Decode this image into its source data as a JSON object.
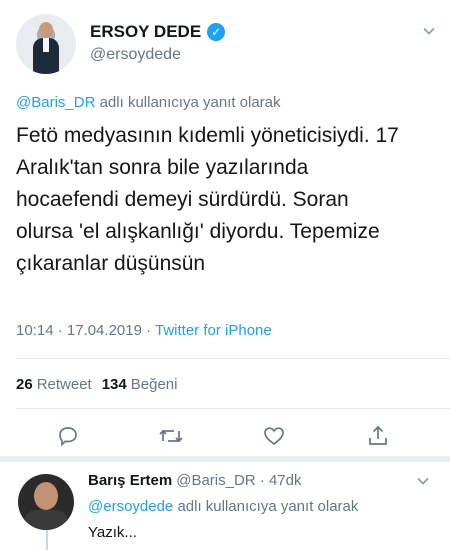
{
  "tweet": {
    "author": {
      "display_name": "ERSOY DEDE",
      "handle": "@ersoydede",
      "verified": true
    },
    "reply_context": {
      "mention": "@Baris_DR",
      "suffix": " adlı kullanıcıya yanıt olarak"
    },
    "text_lines": [
      "Fetö medyasının kıdemli yöneticisiydi. 17",
      "Aralık'tan sonra bile yazılarında",
      "hocaefendi demeyi sürdürdü. Soran",
      "olursa 'el alışkanlığı' diyordu. Tepemize",
      "çıkaranlar düşünsün"
    ],
    "timestamp": "10:14 · 17.04.2019 · ",
    "source": "Twitter for iPhone",
    "stats": {
      "retweet_count": "26",
      "retweet_label": "Retweet",
      "like_count": "134",
      "like_label": "Beğeni"
    },
    "actions": [
      "reply-icon",
      "retweet-icon",
      "like-icon",
      "share-icon"
    ]
  },
  "reply": {
    "display_name": "Barış Ertem",
    "handle_time": "@Baris_DR · 47dk",
    "context_mention": "@ersoydede",
    "context_suffix": " adlı kullanıcıya yanıt olarak",
    "text": "Yazık..."
  },
  "colors": {
    "accent": "#1da1f2",
    "secondary_text": "#657786",
    "primary_text": "#14171a",
    "divider": "#e1e8ed"
  }
}
